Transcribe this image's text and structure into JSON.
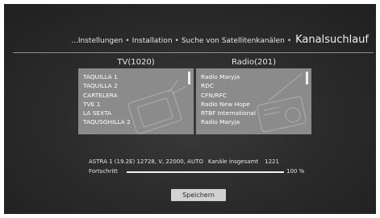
{
  "breadcrumb": {
    "items": [
      "...Instellungen",
      "Installation",
      "Suche von Satellitenkanälen"
    ],
    "separator": "•",
    "current": "Kanalsuchlauf"
  },
  "tv": {
    "header": "TV(1020)",
    "channels": [
      "TAQUILLA 1",
      "TAQUILLA 2",
      "CARTELERA",
      "TVE 1",
      "LA SEXTA",
      "TAQUSGHILLA 2"
    ]
  },
  "radio": {
    "header": "Radio(201)",
    "channels": [
      "Radio Maryja",
      "RDC",
      "CFN/RFC",
      "Radio New Hope",
      "RTBF International",
      "Radio Maryja"
    ]
  },
  "status": {
    "transponder": "ASTRA 1 (19.2E) 12728, V, 22000, AUTO",
    "total_label": "Kanäle insgesamt",
    "total_value": "1221"
  },
  "progress": {
    "label": "Fortschritt",
    "value": 100,
    "text": "100 %"
  },
  "save_button": "Speichern",
  "colors": {
    "background": "#2b2b2b",
    "panel": "#8b8b8b",
    "text": "#e6e6e6",
    "button": "#d2d2d2"
  }
}
